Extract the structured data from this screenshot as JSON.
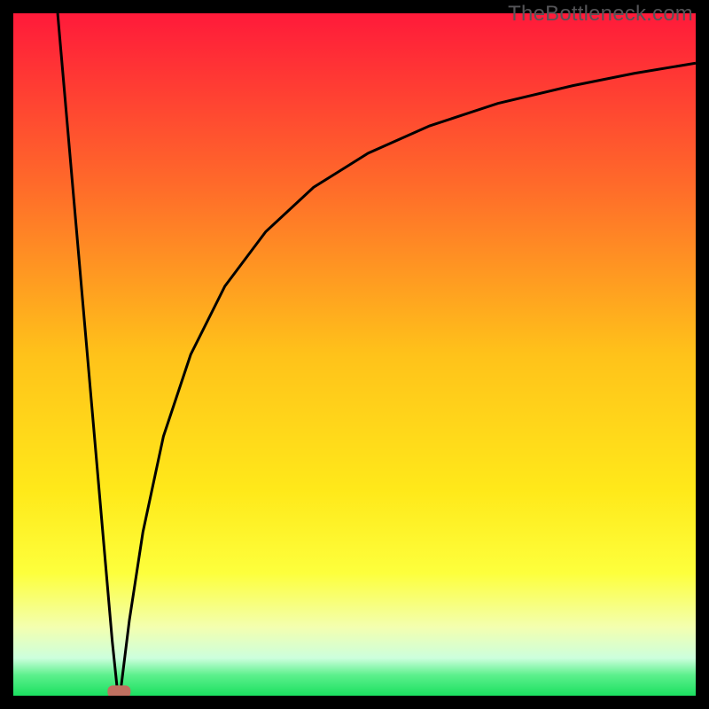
{
  "watermark": "TheBottleneck.com",
  "chart_data": {
    "type": "line",
    "title": "",
    "xlabel": "",
    "ylabel": "",
    "xlim": [
      0,
      100
    ],
    "ylim": [
      0,
      100
    ],
    "background_gradient": {
      "stops": [
        {
          "offset": 0,
          "color": "#ff1a3a"
        },
        {
          "offset": 0.25,
          "color": "#ff6a2a"
        },
        {
          "offset": 0.5,
          "color": "#ffc21a"
        },
        {
          "offset": 0.7,
          "color": "#ffe91a"
        },
        {
          "offset": 0.82,
          "color": "#fdff3c"
        },
        {
          "offset": 0.9,
          "color": "#f3ffb0"
        },
        {
          "offset": 0.945,
          "color": "#ccffdd"
        },
        {
          "offset": 0.97,
          "color": "#5cf08c"
        },
        {
          "offset": 1.0,
          "color": "#1be060"
        }
      ]
    },
    "series": [
      {
        "name": "left-branch",
        "x": [
          6.5,
          7.5,
          8.5,
          9.5,
          10.5,
          11.5,
          12.5,
          13.5,
          14.5,
          15.2
        ],
        "y": [
          100,
          88.5,
          77,
          65.5,
          54,
          42.5,
          31,
          19.5,
          8,
          1.3
        ]
      },
      {
        "name": "right-branch",
        "x": [
          15.8,
          17,
          19,
          22,
          26,
          31,
          37,
          44,
          52,
          61,
          71,
          82,
          91,
          100
        ],
        "y": [
          1.3,
          11,
          24,
          38,
          50,
          60,
          68,
          74.5,
          79.5,
          83.5,
          86.8,
          89.4,
          91.2,
          92.7
        ]
      }
    ],
    "marker": {
      "name": "minimum-marker",
      "x": 15.5,
      "y": 0.6,
      "color": "#c07060"
    }
  }
}
